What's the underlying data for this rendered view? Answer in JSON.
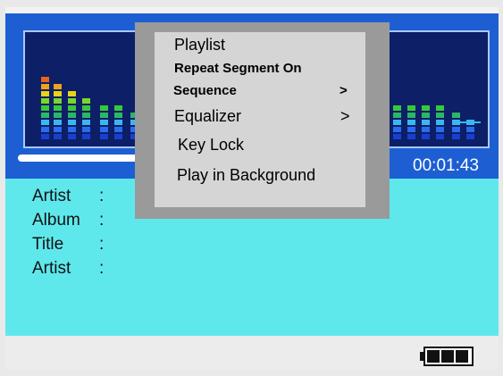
{
  "player": {
    "time": "00:01:43",
    "progress_fraction": 0.28
  },
  "track_info": {
    "rows": [
      {
        "label": "Artist",
        "sep": ":"
      },
      {
        "label": "Album",
        "sep": ":"
      },
      {
        "label": "Title",
        "sep": ":"
      },
      {
        "label": "Artist",
        "sep": ":"
      }
    ]
  },
  "popup_menu": {
    "items": [
      {
        "label": "Playlist",
        "arrow": ""
      },
      {
        "label": "Repeat Segment On",
        "arrow": ""
      },
      {
        "label": "Sequence",
        "arrow": ">"
      },
      {
        "label": "Equalizer",
        "arrow": ">"
      },
      {
        "label": "Key Lock",
        "arrow": ""
      },
      {
        "label": "Play in Background",
        "arrow": ""
      }
    ]
  },
  "status": {
    "battery_icon": "battery-icon",
    "battery_level_bars": 3
  },
  "colors": {
    "player_bg": "#1d5fd3",
    "info_bg": "#5fe8ec",
    "popup_bg": "#d5d5d5",
    "popup_shadow": "#9a9a9a"
  }
}
